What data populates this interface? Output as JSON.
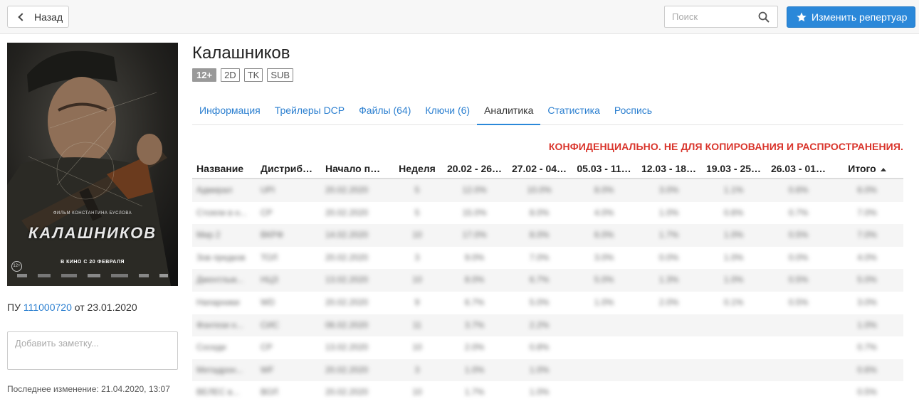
{
  "header": {
    "back_label": "Назад",
    "search_placeholder": "Поиск",
    "edit_label": "Изменить репертуар"
  },
  "film": {
    "title": "Калашников",
    "badges": [
      "12+",
      "2D",
      "TK",
      "SUB"
    ],
    "poster": {
      "top_text": "ФИЛЬМ КОНСТАНТИНА БУСЛОВА",
      "title_text": "КАЛАШНИКОВ",
      "release_text": "В КИНО С 20 ФЕВРАЛЯ",
      "age_text": "12+"
    },
    "pu_prefix": "ПУ",
    "pu_number": "111000720",
    "pu_suffix": "от 23.01.2020",
    "note_placeholder": "Добавить заметку...",
    "last_modified": "Последнее изменение: 21.04.2020, 13:07"
  },
  "tabs": [
    {
      "label": "Информация",
      "active": false
    },
    {
      "label": "Трейлеры DCP",
      "active": false
    },
    {
      "label": "Файлы (64)",
      "active": false
    },
    {
      "label": "Ключи (6)",
      "active": false
    },
    {
      "label": "Аналитика",
      "active": true
    },
    {
      "label": "Статистика",
      "active": false
    },
    {
      "label": "Роспись",
      "active": false
    }
  ],
  "confidential_text": "КОНФИДЕНЦИАЛЬНО. НЕ ДЛЯ КОПИРОВАНИЯ И РАСПРОСТРАНЕНИЯ.",
  "table": {
    "columns": [
      "Название",
      "Дистриб…",
      "Начало п…",
      "Неделя",
      "20.02 - 26…",
      "27.02 - 04…",
      "05.03 - 11…",
      "12.03 - 18…",
      "19.03 - 25…",
      "26.03 - 01…",
      "Итого"
    ],
    "rows": [
      [
        "Адмирал",
        "UPI",
        "20.02.2020",
        "5",
        "12.0%",
        "10.0%",
        "8.0%",
        "3.0%",
        "1.1%",
        "0.6%",
        "6.0%"
      ],
      [
        "Стояли в н...",
        "CP",
        "20.02.2020",
        "5",
        "15.0%",
        "8.0%",
        "4.0%",
        "1.0%",
        "0.6%",
        "0.7%",
        "7.0%"
      ],
      [
        "Мир 2",
        "ВКРФ",
        "14.02.2020",
        "10",
        "17.0%",
        "8.0%",
        "6.0%",
        "1.7%",
        "1.0%",
        "0.5%",
        "7.0%"
      ],
      [
        "Зов предков",
        "ТОЛ",
        "20.02.2020",
        "3",
        "9.0%",
        "7.0%",
        "3.0%",
        "0.0%",
        "1.0%",
        "0.0%",
        "4.0%"
      ],
      [
        "Джентльм...",
        "НЦЗ",
        "13.02.2020",
        "10",
        "8.0%",
        "6.7%",
        "5.0%",
        "1.3%",
        "1.0%",
        "0.5%",
        "5.0%"
      ],
      [
        "Напарники",
        "WD",
        "20.02.2020",
        "9",
        "6.7%",
        "5.0%",
        "1.0%",
        "2.0%",
        "0.1%",
        "0.5%",
        "3.0%"
      ],
      [
        "Фэнтези н...",
        "СИС",
        "06.02.2020",
        "11",
        "3.7%",
        "2.2%",
        "",
        "",
        "",
        "",
        "1.0%"
      ],
      [
        "Соседи",
        "CP",
        "13.02.2020",
        "10",
        "2.0%",
        "0.8%",
        "",
        "",
        "",
        "",
        "0.7%"
      ],
      [
        "Метадрон...",
        "WF",
        "20.02.2020",
        "3",
        "1.0%",
        "1.0%",
        "",
        "",
        "",
        "",
        "0.6%"
      ],
      [
        "ВЕЛЕС в...",
        "ВОЛ",
        "20.02.2020",
        "10",
        "1.7%",
        "1.0%",
        "",
        "",
        "",
        "",
        "0.5%"
      ]
    ]
  }
}
